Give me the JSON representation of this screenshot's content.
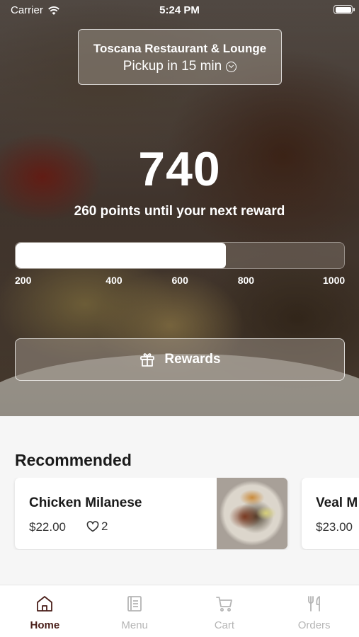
{
  "status_bar": {
    "carrier": "Carrier",
    "time": "5:24 PM"
  },
  "store": {
    "name": "Toscana Restaurant & Lounge",
    "pickup": "Pickup in 15 min"
  },
  "loyalty": {
    "points": "740",
    "note": "260 points until your next reward",
    "progress_value": 740,
    "progress_min": 100,
    "progress_max": 1100,
    "ticks": [
      "200",
      "400",
      "600",
      "800",
      "1000"
    ]
  },
  "rewards_button": {
    "label": "Rewards",
    "icon": "gift-icon"
  },
  "recommended": {
    "title": "Recommended",
    "items": [
      {
        "name": "Chicken Milanese",
        "price": "$22.00",
        "likes": "2"
      },
      {
        "name": "Veal M",
        "price": "$23.00"
      }
    ]
  },
  "tab_bar": {
    "tabs": [
      {
        "label": "Home",
        "icon": "home-icon",
        "active": true
      },
      {
        "label": "Menu",
        "icon": "menu-book-icon",
        "active": false
      },
      {
        "label": "Cart",
        "icon": "cart-icon",
        "active": false
      },
      {
        "label": "Orders",
        "icon": "fork-knife-icon",
        "active": false
      }
    ]
  },
  "colors": {
    "accent": "#4a1f1a",
    "inactive_tab": "#b5b5b5"
  }
}
